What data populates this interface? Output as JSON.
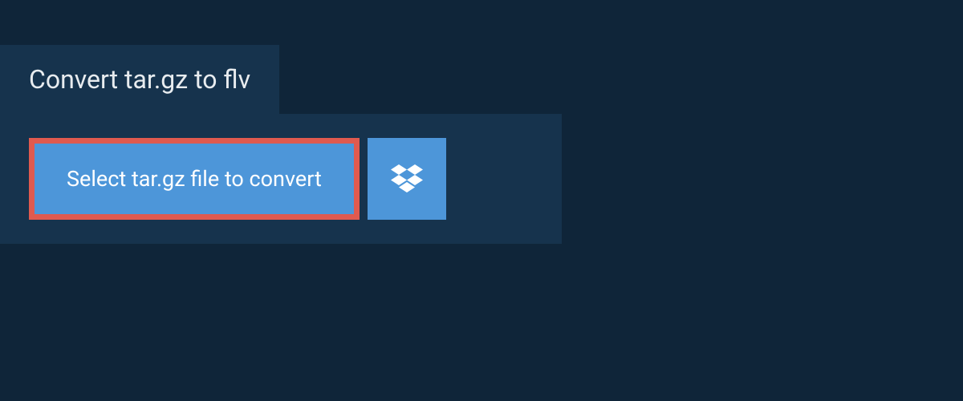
{
  "header": {
    "title": "Convert tar.gz to flv"
  },
  "upload": {
    "select_label": "Select tar.gz file to convert",
    "dropbox_icon_name": "dropbox-icon"
  },
  "colors": {
    "page_bg": "#0f2539",
    "panel_bg": "#16334d",
    "button_bg": "#4d96d9",
    "highlight_border": "#e05a4f",
    "text_light": "#e8ecef",
    "text_white": "#ffffff"
  }
}
